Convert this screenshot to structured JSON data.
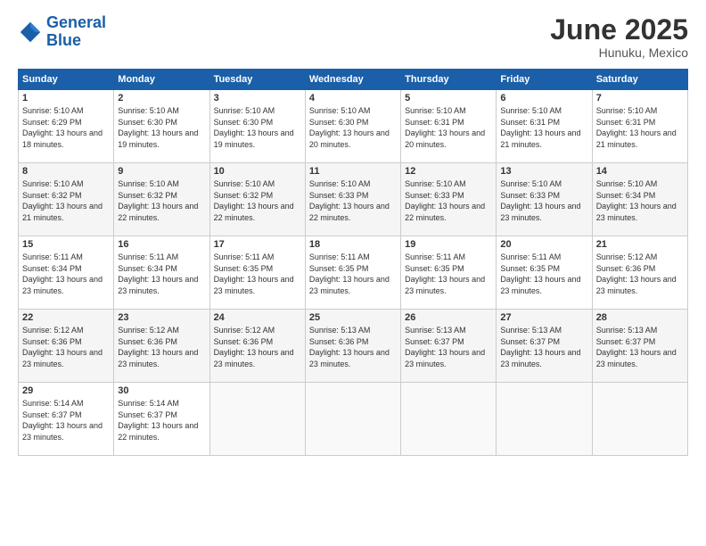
{
  "header": {
    "logo_line1": "General",
    "logo_line2": "Blue",
    "month": "June 2025",
    "location": "Hunuku, Mexico"
  },
  "days_of_week": [
    "Sunday",
    "Monday",
    "Tuesday",
    "Wednesday",
    "Thursday",
    "Friday",
    "Saturday"
  ],
  "weeks": [
    [
      {
        "day": "1",
        "sunrise": "5:10 AM",
        "sunset": "6:29 PM",
        "daylight": "13 hours and 18 minutes."
      },
      {
        "day": "2",
        "sunrise": "5:10 AM",
        "sunset": "6:30 PM",
        "daylight": "13 hours and 19 minutes."
      },
      {
        "day": "3",
        "sunrise": "5:10 AM",
        "sunset": "6:30 PM",
        "daylight": "13 hours and 19 minutes."
      },
      {
        "day": "4",
        "sunrise": "5:10 AM",
        "sunset": "6:30 PM",
        "daylight": "13 hours and 20 minutes."
      },
      {
        "day": "5",
        "sunrise": "5:10 AM",
        "sunset": "6:31 PM",
        "daylight": "13 hours and 20 minutes."
      },
      {
        "day": "6",
        "sunrise": "5:10 AM",
        "sunset": "6:31 PM",
        "daylight": "13 hours and 21 minutes."
      },
      {
        "day": "7",
        "sunrise": "5:10 AM",
        "sunset": "6:31 PM",
        "daylight": "13 hours and 21 minutes."
      }
    ],
    [
      {
        "day": "8",
        "sunrise": "5:10 AM",
        "sunset": "6:32 PM",
        "daylight": "13 hours and 21 minutes."
      },
      {
        "day": "9",
        "sunrise": "5:10 AM",
        "sunset": "6:32 PM",
        "daylight": "13 hours and 22 minutes."
      },
      {
        "day": "10",
        "sunrise": "5:10 AM",
        "sunset": "6:32 PM",
        "daylight": "13 hours and 22 minutes."
      },
      {
        "day": "11",
        "sunrise": "5:10 AM",
        "sunset": "6:33 PM",
        "daylight": "13 hours and 22 minutes."
      },
      {
        "day": "12",
        "sunrise": "5:10 AM",
        "sunset": "6:33 PM",
        "daylight": "13 hours and 22 minutes."
      },
      {
        "day": "13",
        "sunrise": "5:10 AM",
        "sunset": "6:33 PM",
        "daylight": "13 hours and 23 minutes."
      },
      {
        "day": "14",
        "sunrise": "5:10 AM",
        "sunset": "6:34 PM",
        "daylight": "13 hours and 23 minutes."
      }
    ],
    [
      {
        "day": "15",
        "sunrise": "5:11 AM",
        "sunset": "6:34 PM",
        "daylight": "13 hours and 23 minutes."
      },
      {
        "day": "16",
        "sunrise": "5:11 AM",
        "sunset": "6:34 PM",
        "daylight": "13 hours and 23 minutes."
      },
      {
        "day": "17",
        "sunrise": "5:11 AM",
        "sunset": "6:35 PM",
        "daylight": "13 hours and 23 minutes."
      },
      {
        "day": "18",
        "sunrise": "5:11 AM",
        "sunset": "6:35 PM",
        "daylight": "13 hours and 23 minutes."
      },
      {
        "day": "19",
        "sunrise": "5:11 AM",
        "sunset": "6:35 PM",
        "daylight": "13 hours and 23 minutes."
      },
      {
        "day": "20",
        "sunrise": "5:11 AM",
        "sunset": "6:35 PM",
        "daylight": "13 hours and 23 minutes."
      },
      {
        "day": "21",
        "sunrise": "5:12 AM",
        "sunset": "6:36 PM",
        "daylight": "13 hours and 23 minutes."
      }
    ],
    [
      {
        "day": "22",
        "sunrise": "5:12 AM",
        "sunset": "6:36 PM",
        "daylight": "13 hours and 23 minutes."
      },
      {
        "day": "23",
        "sunrise": "5:12 AM",
        "sunset": "6:36 PM",
        "daylight": "13 hours and 23 minutes."
      },
      {
        "day": "24",
        "sunrise": "5:12 AM",
        "sunset": "6:36 PM",
        "daylight": "13 hours and 23 minutes."
      },
      {
        "day": "25",
        "sunrise": "5:13 AM",
        "sunset": "6:36 PM",
        "daylight": "13 hours and 23 minutes."
      },
      {
        "day": "26",
        "sunrise": "5:13 AM",
        "sunset": "6:37 PM",
        "daylight": "13 hours and 23 minutes."
      },
      {
        "day": "27",
        "sunrise": "5:13 AM",
        "sunset": "6:37 PM",
        "daylight": "13 hours and 23 minutes."
      },
      {
        "day": "28",
        "sunrise": "5:13 AM",
        "sunset": "6:37 PM",
        "daylight": "13 hours and 23 minutes."
      }
    ],
    [
      {
        "day": "29",
        "sunrise": "5:14 AM",
        "sunset": "6:37 PM",
        "daylight": "13 hours and 23 minutes."
      },
      {
        "day": "30",
        "sunrise": "5:14 AM",
        "sunset": "6:37 PM",
        "daylight": "13 hours and 22 minutes."
      },
      null,
      null,
      null,
      null,
      null
    ]
  ]
}
